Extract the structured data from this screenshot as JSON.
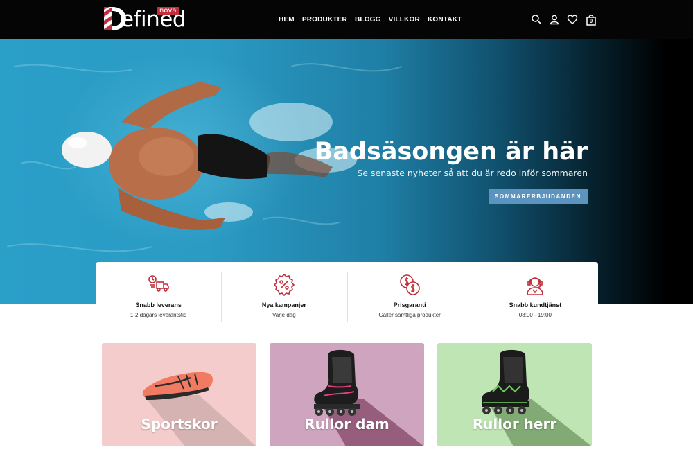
{
  "header": {
    "logo_text": "efined",
    "logo_badge": "nova",
    "nav": [
      "HEM",
      "PRODUKTER",
      "BLOGG",
      "VILLKOR",
      "KONTAKT"
    ],
    "cart_count": "0"
  },
  "hero": {
    "title": "Badsäsongen är här",
    "subtitle": "Se senaste nyheter så att du är redo inför sommaren",
    "cta": "SOMMARERBJUDANDEN"
  },
  "features": [
    {
      "icon": "delivery-truck-icon",
      "title": "Snabb leverans",
      "text": "1-2 dagars leverantstid"
    },
    {
      "icon": "percent-badge-icon",
      "title": "Nya kampanjer",
      "text": "Varje dag"
    },
    {
      "icon": "coins-icon",
      "title": "Prisgaranti",
      "text": "Gäller samtliga produkter"
    },
    {
      "icon": "support-agent-icon",
      "title": "Snabb kundtjänst",
      "text": "08:00 - 19:00"
    }
  ],
  "categories": [
    {
      "label": "Sportskor",
      "bg": "#f4cccc",
      "icon": "running-shoe-icon"
    },
    {
      "label": "Rullor dam",
      "bg": "#cfa4bf",
      "icon": "inline-skate-icon"
    },
    {
      "label": "Rullor herr",
      "bg": "#bfe5b4",
      "icon": "inline-skate-icon"
    }
  ],
  "colors": {
    "accent": "#c0303c",
    "cta": "#5d93bf",
    "header_bg": "#050505"
  }
}
